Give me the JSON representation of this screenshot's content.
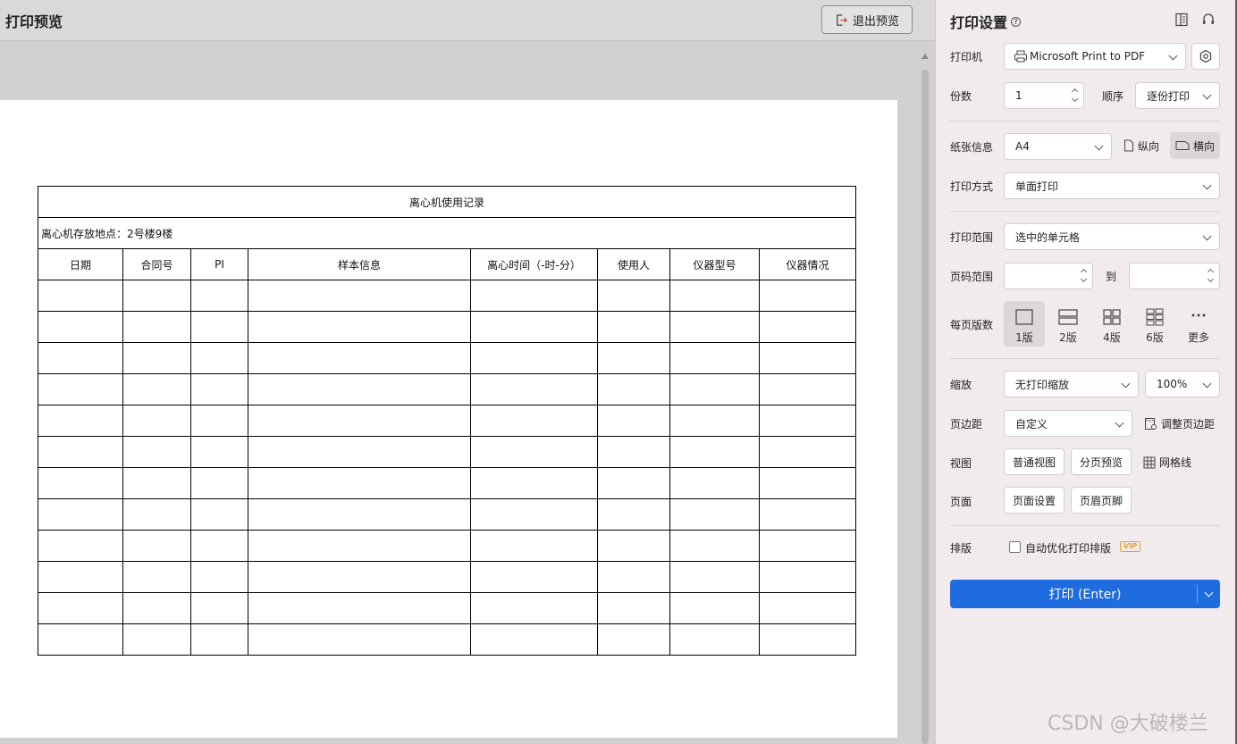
{
  "preview": {
    "title": "打印预览",
    "exit_label": "退出预览"
  },
  "sheet": {
    "table_title": "离心机使用记录",
    "location": "离心机存放地点：2号楼9楼",
    "columns": [
      "日期",
      "合同号",
      "PI",
      "样本信息",
      "离心时间（-时-分）",
      "使用人",
      "仪器型号",
      "仪器情况"
    ],
    "empty_row_count": 12
  },
  "panel": {
    "title": "打印设置",
    "printer_label": "打印机",
    "printer_value": "Microsoft Print to PDF",
    "copies_label": "份数",
    "copies_value": "1",
    "order_label": "顺序",
    "order_value": "逐份打印",
    "paper_label": "纸张信息",
    "paper_value": "A4",
    "portrait_label": "纵向",
    "landscape_label": "横向",
    "print_mode_label": "打印方式",
    "print_mode_value": "单面打印",
    "range_label": "打印范围",
    "range_value": "选中的单元格",
    "page_range_label": "页码范围",
    "page_range_to": "到",
    "per_page_label": "每页版数",
    "per_page_options": [
      "1版",
      "2版",
      "4版",
      "6版",
      "更多"
    ],
    "per_page_selected": "1版",
    "scale_label": "缩放",
    "scale_value": "无打印缩放",
    "scale_percent": "100%",
    "margin_label": "页边距",
    "margin_value": "自定义",
    "adjust_margin_label": "调整页边距",
    "view_label": "视图",
    "normal_view_label": "普通视图",
    "page_break_label": "分页预览",
    "gridlines_label": "网格线",
    "page_label": "页面",
    "page_setup_label": "页面设置",
    "header_footer_label": "页眉页脚",
    "typeset_label": "排版",
    "auto_optimize_label": "自动优化打印排版",
    "vip_label": "VIP",
    "print_button_label": "打印 (Enter)"
  },
  "watermark": "CSDN @大破楼兰",
  "colors": {
    "accent": "#1f6ce0",
    "panel_bg": "#f1ebed",
    "preview_bg": "#d1d1d1",
    "vip": "#e2a23a"
  }
}
